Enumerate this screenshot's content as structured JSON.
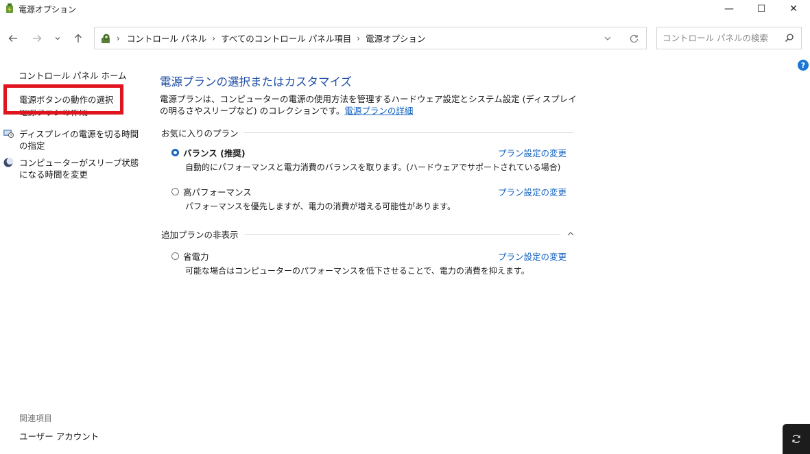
{
  "window": {
    "title": "電源オプション",
    "icon": "power-options-icon",
    "controls": {
      "minimize": "—",
      "maximize": "☐",
      "close": "✕"
    }
  },
  "nav": {
    "back_icon": "back-arrow-icon",
    "forward_icon": "forward-arrow-icon",
    "recent_icon": "chevron-down-icon",
    "up_icon": "up-arrow-icon",
    "breadcrumbs": [
      "コントロール パネル",
      "すべてのコントロール パネル項目",
      "電源オプション"
    ],
    "search_placeholder": "コントロール パネルの検索"
  },
  "left_pane": {
    "home": "コントロール パネル ホーム",
    "links": {
      "power_button": "電源ボタンの動作の選択",
      "create_plan": "電源プランの作成",
      "display_off": "ディスプレイの電源を切る時間の指定",
      "sleep": "コンピューターがスリープ状態になる時間を変更"
    },
    "related_heading": "関連項目",
    "related_user": "ユーザー アカウント"
  },
  "main": {
    "title": "電源プランの選択またはカスタマイズ",
    "description": "電源プランは、コンピューターの電源の使用方法を管理するハードウェア設定とシステム設定 (ディスプレイの明るさやスリープなど) のコレクションです。",
    "description_link": "電源プランの詳細",
    "favorites_heading": "お気に入りのプラン",
    "hidden_heading": "追加プランの非表示",
    "change_link": "プラン設定の変更",
    "plans": [
      {
        "name": "バランス (推奨)",
        "description": "自動的にパフォーマンスと電力消費のバランスを取ります。(ハードウェアでサポートされている場合)",
        "selected": true
      },
      {
        "name": "高パフォーマンス",
        "description": "パフォーマンスを優先しますが、電力の消費が増える可能性があります。",
        "selected": false
      },
      {
        "name": "省電力",
        "description": "可能な場合はコンピューターのパフォーマンスを低下させることで、電力の消費を抑えます。",
        "selected": false
      }
    ]
  },
  "colors": {
    "title_blue": "#1f4fa5",
    "link_blue": "#1060c0",
    "highlight_red": "#e0141e",
    "radio_selected": "#1565c0"
  }
}
